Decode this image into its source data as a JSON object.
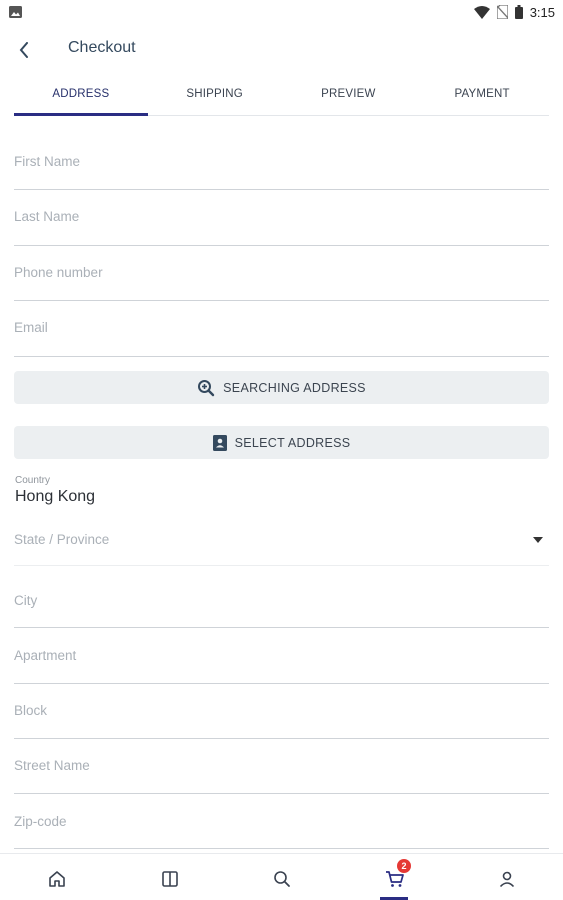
{
  "status_bar": {
    "time": "3:15"
  },
  "header": {
    "title": "Checkout"
  },
  "tabs": [
    {
      "label": "ADDRESS"
    },
    {
      "label": "SHIPPING"
    },
    {
      "label": "PREVIEW"
    },
    {
      "label": "PAYMENT"
    }
  ],
  "form": {
    "first_name": {
      "placeholder": "First Name",
      "value": ""
    },
    "last_name": {
      "placeholder": "Last Name",
      "value": ""
    },
    "phone": {
      "placeholder": "Phone number",
      "value": ""
    },
    "email": {
      "placeholder": "Email",
      "value": ""
    },
    "search_address_label": "SEARCHING ADDRESS",
    "select_address_label": "SELECT ADDRESS",
    "country_label": "Country",
    "country_value": "Hong Kong",
    "state": {
      "placeholder": "State / Province",
      "value": ""
    },
    "city": {
      "placeholder": "City",
      "value": ""
    },
    "apartment": {
      "placeholder": "Apartment",
      "value": ""
    },
    "block": {
      "placeholder": "Block",
      "value": ""
    },
    "street": {
      "placeholder": "Street Name",
      "value": ""
    },
    "zip": {
      "placeholder": "Zip-code",
      "value": ""
    }
  },
  "bottom_nav": {
    "items": [
      "home-icon",
      "catalog-icon",
      "search-icon",
      "cart-icon",
      "profile-icon"
    ],
    "cart_badge": "2"
  },
  "colors": {
    "accent": "#2a2d83",
    "badge": "#e53935",
    "button_bg": "#eceff1"
  }
}
